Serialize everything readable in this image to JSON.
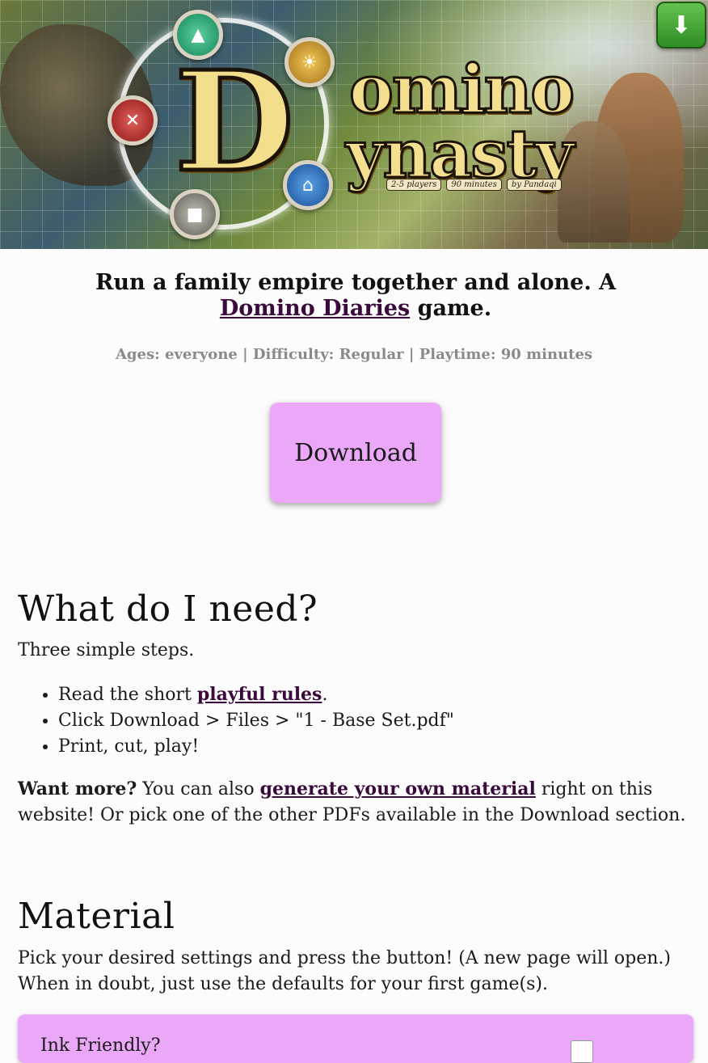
{
  "header": {
    "logo_title_line1": "omino",
    "logo_title_line2": "ynasty",
    "logo_letter": "D",
    "tags": [
      "2-5 players",
      "90 minutes",
      "by Pandaqi"
    ],
    "download_icon": "download-arrow-icon"
  },
  "intro": {
    "tagline_text": "Run a family empire together and alone. A",
    "tagline_link": "Domino Diaries",
    "tagline_suffix": "game.",
    "meta": "Ages: everyone | Difficulty: Regular | Playtime: 90 minutes",
    "download_label": "Download"
  },
  "need": {
    "heading": "What do I need?",
    "intro": "Three simple steps.",
    "step1_prefix": "Read the short ",
    "step1_link": "playful rules",
    "step1_suffix": ".",
    "step2": "Click Download > Files > \"1 - Base Set.pdf\"",
    "step3": "Print, cut, play!",
    "more_bold": "Want more?",
    "more_text1": " You can also ",
    "more_link": "generate your own material",
    "more_text2": " right on this website! Or pick one of the other PDFs available in the Download section."
  },
  "material": {
    "heading": "Material",
    "intro": "Pick your desired settings and press the button! (A new page will open.) When in doubt, just use the defaults for your first game(s).",
    "setting_label": "Ink Friendly?"
  },
  "colors": {
    "accent": "#eba8f9",
    "link": "#3a0a3c",
    "meta_grey": "#8a8a8a"
  }
}
